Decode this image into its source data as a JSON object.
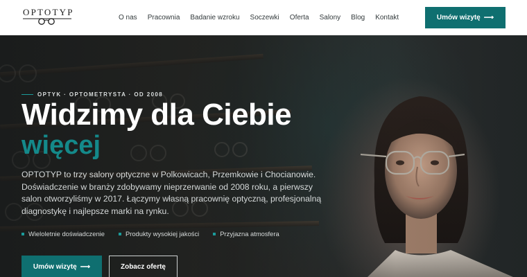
{
  "header": {
    "logo_text": "OPTOTYP",
    "nav": [
      "O nas",
      "Pracownia",
      "Badanie wzroku",
      "Soczewki",
      "Oferta",
      "Salony",
      "Blog",
      "Kontakt"
    ],
    "cta_label": "Umów wizytę",
    "cta_arrow": "⟶"
  },
  "hero": {
    "tagline": "OPTYK · OPTOMETRYSTA · OD 2008",
    "title_line1": "Widzimy dla Ciebie",
    "title_line2": "więcej",
    "description": "OPTOTYP to trzy salony optyczne w Polkowicach, Przemkowie i Chocianowie. Doświadczenie w branży zdobywamy nieprzerwanie od 2008 roku, a pierwszy salon otworzyliśmy w 2017. Łączymy własną pracownię optyczną, profesjonalną diagnostykę i najlepsze marki na rynku.",
    "features": [
      "Wieloletnie doświadczenie",
      "Produkty wysokiej jakości",
      "Przyjazna atmosfera"
    ],
    "primary_button": "Umów wizytę",
    "primary_arrow": "⟶",
    "secondary_button": "Zobacz ofertę"
  },
  "colors": {
    "accent": "#0f6f70",
    "accent_text": "#14898a",
    "header_bg": "#ffffff",
    "hero_bg": "#2a2c2b"
  }
}
